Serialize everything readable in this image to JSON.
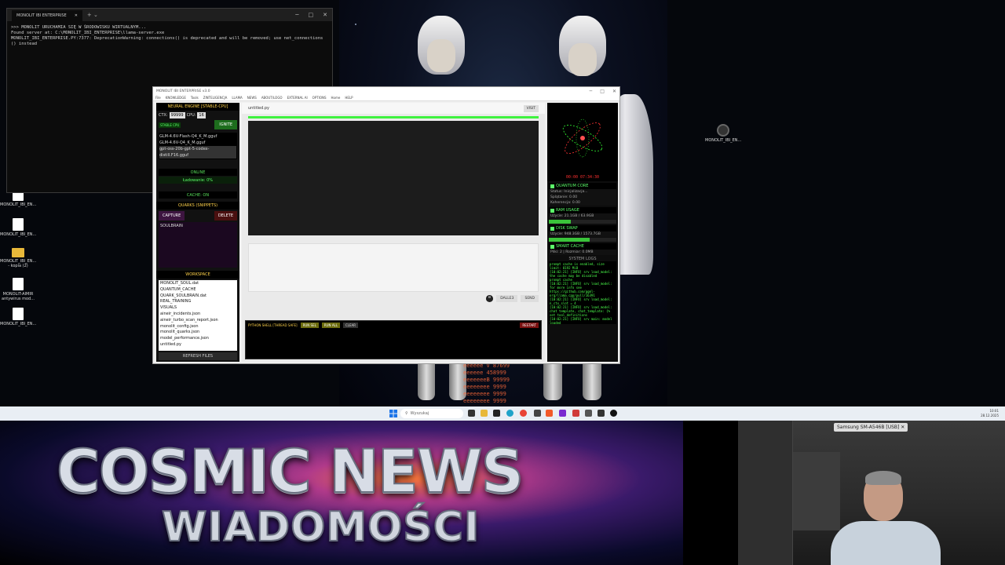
{
  "terminal": {
    "tab_title": "MONOLIT IBI ENTERPRISE",
    "lines": [
      ">>> MONOLIT URUCHAMIA SIĘ W ŚRODOWISKU WIRTUALNYM...",
      "Found server at: C:\\MONOLIT_IBI_ENTERPRISE\\llama-server.exe",
      "MONOLIT_IBI_ENTERPRISE.PY:7377: DeprecationWarning: connections() is deprecated and will be removed; use net_connections",
      "() instead"
    ]
  },
  "app": {
    "title": "MONOLIT IBI ENTERPRISE v3.0",
    "menu": [
      "File",
      "KNOWLEDGE",
      "Tools",
      "ZINTELIGENCJA",
      "LLAMA",
      "NEWS",
      "ABOUT/LOGO",
      "EXTERNAL AI",
      "OPTIONS",
      "Home",
      "HELP"
    ],
    "left": {
      "engine_title": "NEURAL ENGINE [STABLE-CPU]",
      "ctx_label": "CTX:",
      "ctx_value": "99999",
      "cpu_label": "CPU:",
      "cpu_value": "16",
      "stable_badge": "STABLE CPU",
      "ignite_label": "IGNITE",
      "models": [
        "GLM-4.6V-Flash-Q4_K_M.gguf",
        "GLM-4.6V-Q4_K_M.gguf",
        "gpt-oss-20b-gpt-5-codex-distill.F16.gguf"
      ],
      "status_online": "ONLINE",
      "loading": "Ładowanie: 0%",
      "cache": "CACHE: ON",
      "quarks_title": "QUARKS (SNIPPETS)",
      "capture_label": "CAPTURE",
      "delete_label": "DELETE",
      "snippet": "SOULBRAIN",
      "workspace_title": "WORKSPACE",
      "workspace_files": [
        "MONOLIT_SOUL.dat",
        "QUANTUM_CACHE",
        "QUARK_SOULBRAIN.dat",
        "REAL_TRAINING",
        "VISUALS",
        "aineir_incidents.json",
        "aineir_turbo_scan_report.json",
        "monolit_config.json",
        "monolit_quarks.json",
        "model_performance.json",
        "untitled.py"
      ],
      "refresh_label": "REFRESH FILES"
    },
    "center": {
      "tab_name": "untitled.py",
      "visit_label": "VISIT",
      "send_controls": [
        "DALLE3",
        "SEND"
      ],
      "shell_title": "PYTHON SHELL [THREAD SAFE]",
      "shell_buttons": [
        "RUN SEL",
        "RUN ALL",
        "CLEAR"
      ],
      "restart_label": "RESTART"
    },
    "right": {
      "clock": "00:00 07:34:30",
      "quantum_title": "QUANTUM CORE",
      "quantum_lines": [
        "Status: Inicjalizacja...",
        "Splątanie: 0.00",
        "Koherencja: 0.00"
      ],
      "ram_title": "RAM USAGE",
      "ram_text": "Użycie: 21.1GB / 63.9GB",
      "ram_fraction": 0.33,
      "disk_title": "DISK SWAP",
      "disk_text": "Użycie: 948.3GB / 1573.7GB",
      "disk_fraction": 0.6,
      "cache_title": "SMART CACHE",
      "cache_text": "Pliki: 2 | Rozmiar: 0.0MB",
      "logs_title": "SYSTEM LOGS",
      "logs": "prompt cache is enabled, size limit: 8192 MiB\n[10:02:21] [INFO] srv load_model: the cache may be disabled\nprompt cache\n[10:02:21] [INFO] srv load_model: for more info see https://github.com/ggml-org/llama.cpp/pull/16391\n[10:02:21] [INFO] srv load_model: n_ctx_slot = 4\n[10:02:21] [INFO] srv load_model: chat template, chat_template: {% set tool_definitions\n[10:02:21] [INFO] srv main: model loaded\n[10:02:21] [INFO] srv update_slots: all slots are idle"
    }
  },
  "desktop_icons": [
    "MONOLIT_IBI_EN...",
    "MONOLIT_IBI_EN...",
    "MONOLIT_IBI_EN... - kopia (2)",
    "MONOLIT-AIMIR antywirus mod...",
    "MONOLIT_IBI_EN..."
  ],
  "desktop_right_icon": "MONOLIT_IBI_EN...",
  "wallpaper_numbers": "eeeeee V 87699\neeeeee 458999\neeeeeeeB 99999\neeeeeeee 9999\neeeeeeee 9999\neeeeeeee 9999",
  "taskbar": {
    "search_placeholder": "Wyszukaj",
    "time": "10:01",
    "date": "28.12.2025"
  },
  "news": {
    "title": "COSMIC NEWS",
    "subtitle": "WIADOMOŚCI"
  },
  "webcam": {
    "device_label": "Samsung SM-A546B [USB]"
  }
}
